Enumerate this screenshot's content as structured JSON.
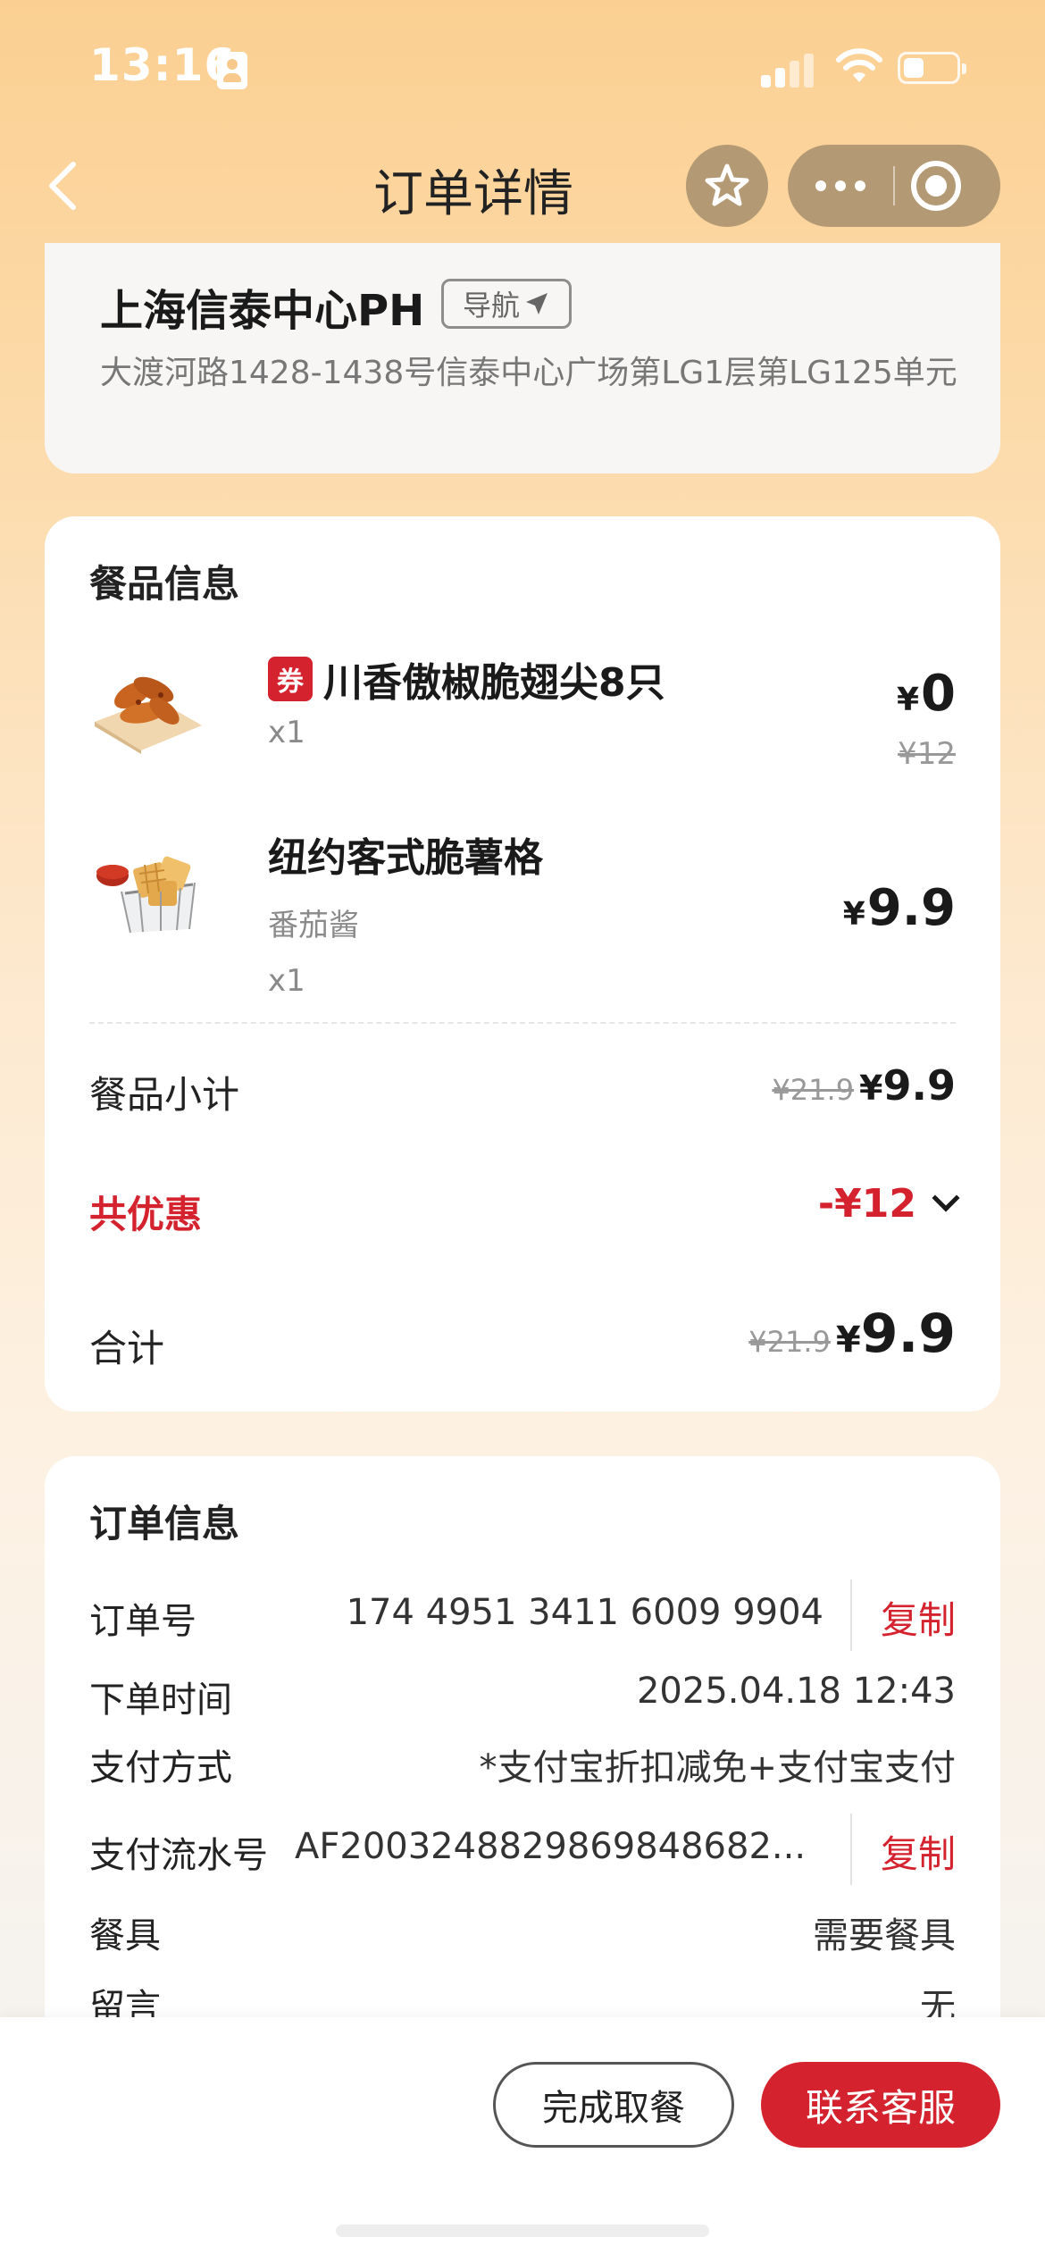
{
  "status_bar": {
    "time": "13:16"
  },
  "nav": {
    "title": "订单详情"
  },
  "store": {
    "name": "上海信泰中心PH",
    "nav_label": "导航",
    "address": "大渡河路1428-1438号信泰中心广场第LG1层第LG125单元"
  },
  "food": {
    "section_title": "餐品信息",
    "items": [
      {
        "badge": "券",
        "name": "川香傲椒脆翅尖8只",
        "qty": "x1",
        "currency": "¥",
        "price": "0",
        "original_price": "¥12"
      },
      {
        "name": "纽约客式脆薯格",
        "option": "番茄酱",
        "qty": "x1",
        "currency": "¥",
        "price": "9.9"
      }
    ],
    "subtotal": {
      "label": "餐品小计",
      "original": "¥21.9",
      "currency": "¥",
      "value": "9.9"
    },
    "discount": {
      "label": "共优惠",
      "value": "-¥12"
    },
    "total": {
      "label": "合计",
      "original": "¥21.9",
      "currency": "¥",
      "value": "9.9"
    }
  },
  "order": {
    "section_title": "订单信息",
    "order_no_label": "订单号",
    "order_no": "174 4951 3411 6009 9904",
    "copy_label": "复制",
    "time_label": "下单时间",
    "time": "2025.04.18 12:43",
    "pay_method_label": "支付方式",
    "pay_method": "*支付宝折扣减免+支付宝支付",
    "serial_label": "支付流水号",
    "serial": "AF2003248829869848682...",
    "cutlery_label": "餐具",
    "cutlery": "需要餐具",
    "note_label": "留言",
    "note": "无"
  },
  "bottom": {
    "pickup_label": "完成取餐",
    "service_label": "联系客服"
  },
  "colors": {
    "accent": "#d4232f",
    "header_bg": "#fbcf92",
    "capsule": "#b49a74"
  }
}
